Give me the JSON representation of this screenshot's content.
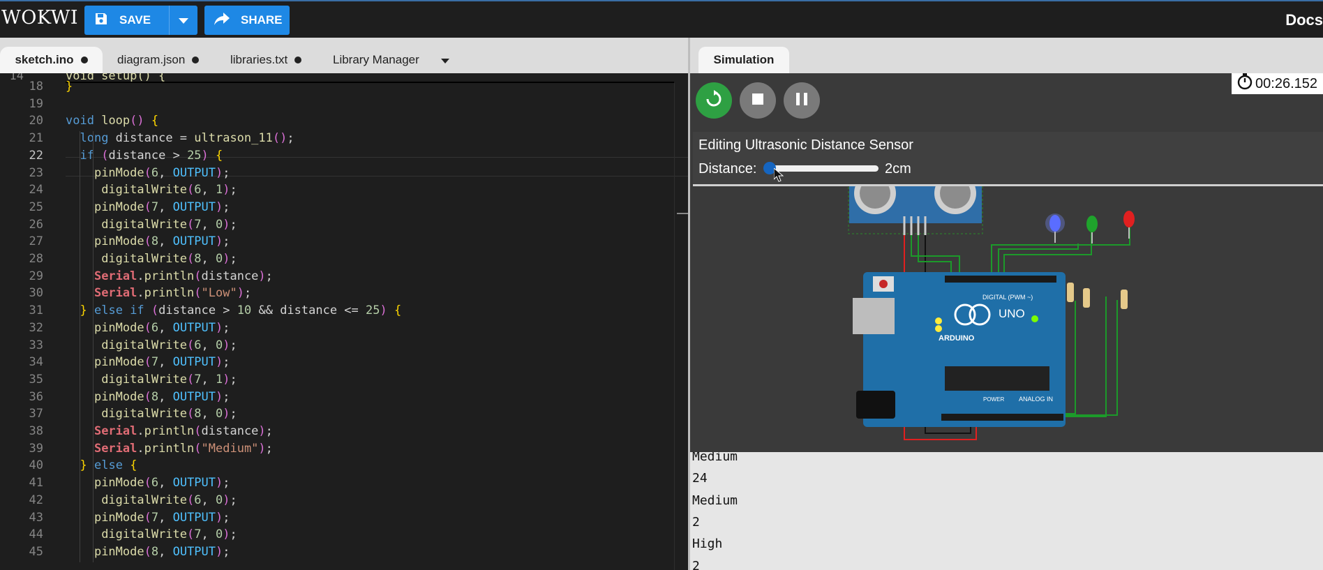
{
  "header": {
    "logo": "WOKWI",
    "save_label": "SAVE",
    "share_label": "SHARE",
    "docs_label": "Docs"
  },
  "editor_tabs": [
    {
      "label": "sketch.ino"
    },
    {
      "label": "diagram.json"
    },
    {
      "label": "libraries.txt"
    },
    {
      "label": "Library Manager"
    }
  ],
  "editor": {
    "partial_top_line": "void setup() {",
    "partial_top_number": "14",
    "line_numbers": [
      "18",
      "19",
      "20",
      "21",
      "22",
      "23",
      "24",
      "25",
      "26",
      "27",
      "28",
      "29",
      "30",
      "31",
      "32",
      "33",
      "34",
      "35",
      "36",
      "37",
      "38",
      "39",
      "40",
      "41",
      "42",
      "43",
      "44",
      "45"
    ],
    "lines": [
      "}",
      "",
      "void loop() {",
      "  long distance = ultrason_11();",
      "  if (distance > 25) {",
      "    pinMode(6, OUTPUT);",
      "     digitalWrite(6, 1);",
      "    pinMode(7, OUTPUT);",
      "     digitalWrite(7, 0);",
      "    pinMode(8, OUTPUT);",
      "     digitalWrite(8, 0);",
      "    Serial.println(distance);",
      "    Serial.println(\"Low\");",
      "  } else if (distance > 10 && distance <= 25) {",
      "    pinMode(6, OUTPUT);",
      "     digitalWrite(6, 0);",
      "    pinMode(7, OUTPUT);",
      "     digitalWrite(7, 1);",
      "    pinMode(8, OUTPUT);",
      "     digitalWrite(8, 0);",
      "    Serial.println(distance);",
      "    Serial.println(\"Medium\");",
      "  } else {",
      "    pinMode(6, OUTPUT);",
      "     digitalWrite(6, 0);",
      "    pinMode(7, OUTPUT);",
      "     digitalWrite(7, 0);",
      "    pinMode(8, OUTPUT);"
    ],
    "current_line": "22"
  },
  "simulation": {
    "tab_label": "Simulation",
    "timer": "00:26.152",
    "editing_title": "Editing Ultrasonic Distance Sensor",
    "distance_label": "Distance:",
    "distance_value": "2cm",
    "distance_slider_fraction": 0.0,
    "board_brand": "ARDUINO",
    "board_model": "UNO",
    "board_text_digital": "DIGITAL (PWM ~)",
    "board_text_analog": "ANALOG IN",
    "board_text_power": "POWER",
    "led_colors": [
      "#4a5cff",
      "#1fa32c",
      "#e02020"
    ]
  },
  "serial_monitor": {
    "lines": [
      "Medium",
      "24",
      "Medium",
      "2",
      "High",
      "2"
    ]
  }
}
